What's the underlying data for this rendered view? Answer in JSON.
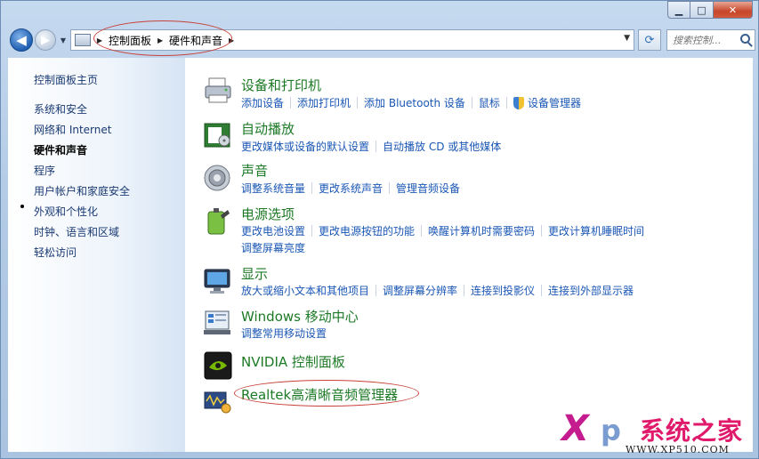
{
  "window": {
    "minimize": "▁",
    "maximize": "□",
    "close": "✕"
  },
  "nav": {
    "back": "◀",
    "forward": "▶",
    "history": "▼",
    "breadcrumbs": [
      "控制面板",
      "硬件和声音"
    ],
    "separator": "▶",
    "address_dropdown": "▼",
    "refresh": "⟳",
    "search_placeholder": "搜索控制..."
  },
  "sidebar": {
    "items": [
      {
        "label": "控制面板主页",
        "active": false
      },
      {
        "label": "系统和安全",
        "active": false
      },
      {
        "label": "网络和 Internet",
        "active": false
      },
      {
        "label": "硬件和声音",
        "active": true
      },
      {
        "label": "程序",
        "active": false
      },
      {
        "label": "用户帐户和家庭安全",
        "active": false
      },
      {
        "label": "外观和个性化",
        "active": false
      },
      {
        "label": "时钟、语言和区域",
        "active": false
      },
      {
        "label": "轻松访问",
        "active": false
      }
    ]
  },
  "categories": [
    {
      "title": "设备和打印机",
      "icon": "printer-icon",
      "links": [
        "添加设备",
        "添加打印机",
        "添加 Bluetooth 设备",
        "鼠标",
        "设备管理器"
      ]
    },
    {
      "title": "自动播放",
      "icon": "autoplay-icon",
      "links": [
        "更改媒体或设备的默认设置",
        "自动播放 CD 或其他媒体"
      ]
    },
    {
      "title": "声音",
      "icon": "speaker-icon",
      "links": [
        "调整系统音量",
        "更改系统声音",
        "管理音频设备"
      ]
    },
    {
      "title": "电源选项",
      "icon": "battery-icon",
      "links": [
        "更改电池设置",
        "更改电源按钮的功能",
        "唤醒计算机时需要密码",
        "更改计算机睡眠时间"
      ],
      "links2": [
        "调整屏幕亮度"
      ]
    },
    {
      "title": "显示",
      "icon": "monitor-icon",
      "links": [
        "放大或缩小文本和其他项目",
        "调整屏幕分辨率",
        "连接到投影仪",
        "连接到外部显示器"
      ]
    },
    {
      "title": "Windows 移动中心",
      "icon": "mobility-center-icon",
      "links": [
        "调整常用移动设置"
      ]
    },
    {
      "title": "NVIDIA 控制面板",
      "icon": "nvidia-icon",
      "links": []
    },
    {
      "title": "Realtek高清晰音频管理器",
      "icon": "realtek-icon",
      "links": []
    }
  ],
  "watermark": {
    "logo_x": "X",
    "logo_p": "p",
    "brand": "系统之家",
    "url": "WWW.XP510.COM"
  },
  "colors": {
    "link": "#1a57b5",
    "title": "#1c7a25",
    "annotation": "#c8413a"
  }
}
